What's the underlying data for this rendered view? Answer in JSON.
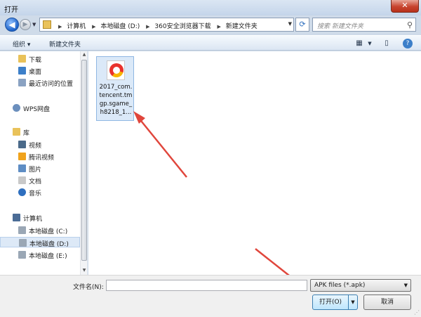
{
  "window": {
    "title": "打开",
    "close_label": "✕"
  },
  "nav": {
    "breadcrumbs": [
      "计算机",
      "本地磁盘 (D:)",
      "360安全浏览器下载",
      "新建文件夹"
    ],
    "search_placeholder": "搜索 新建文件夹"
  },
  "toolbar": {
    "organize": "组织 ▾",
    "new_folder": "新建文件夹"
  },
  "sidebar": {
    "items": [
      {
        "label": "下载",
        "icon": "download-folder-icon",
        "color": "#e9c25a",
        "level": "child"
      },
      {
        "label": "桌面",
        "icon": "desktop-icon",
        "color": "#3c7fc9",
        "level": "child"
      },
      {
        "label": "最近访问的位置",
        "icon": "recent-places-icon",
        "color": "#8aa2c2",
        "level": "child"
      },
      {
        "label": "WPS网盘",
        "icon": "cloud-icon",
        "color": "#6b8fbd",
        "level": "root"
      },
      {
        "label": "库",
        "icon": "library-icon",
        "color": "#e9c25a",
        "level": "root"
      },
      {
        "label": "视频",
        "icon": "video-icon",
        "color": "#4a6a8a",
        "level": "child"
      },
      {
        "label": "腾讯视频",
        "icon": "tencent-video-icon",
        "color": "#f0a31c",
        "level": "child"
      },
      {
        "label": "图片",
        "icon": "pictures-icon",
        "color": "#5e8dc4",
        "level": "child"
      },
      {
        "label": "文档",
        "icon": "documents-icon",
        "color": "#c9c9c9",
        "level": "child"
      },
      {
        "label": "音乐",
        "icon": "music-icon",
        "color": "#2e6fbf",
        "level": "child"
      },
      {
        "label": "计算机",
        "icon": "computer-icon",
        "color": "#4b6c96",
        "level": "root"
      },
      {
        "label": "本地磁盘 (C:)",
        "icon": "drive-c-icon",
        "color": "#9aa7b5",
        "level": "child"
      },
      {
        "label": "本地磁盘 (D:)",
        "icon": "drive-d-icon",
        "color": "#9aa7b5",
        "level": "child",
        "selected": true
      },
      {
        "label": "本地磁盘 (E:)",
        "icon": "drive-e-icon",
        "color": "#9aa7b5",
        "level": "child"
      }
    ]
  },
  "files": [
    {
      "name": "2017_com.tencent.tmgp.sgame_h8218_1...",
      "icon": "apk-game-icon"
    }
  ],
  "bottom": {
    "filename_label": "文件名(N):",
    "filename_value": "",
    "filter": "APK files (*.apk)",
    "open_label": "打开(O)",
    "cancel_label": "取消"
  },
  "colors": {
    "accent": "#3c7fb1",
    "annotation_arrow": "#e0463c",
    "selection": "#dbe9f8"
  }
}
